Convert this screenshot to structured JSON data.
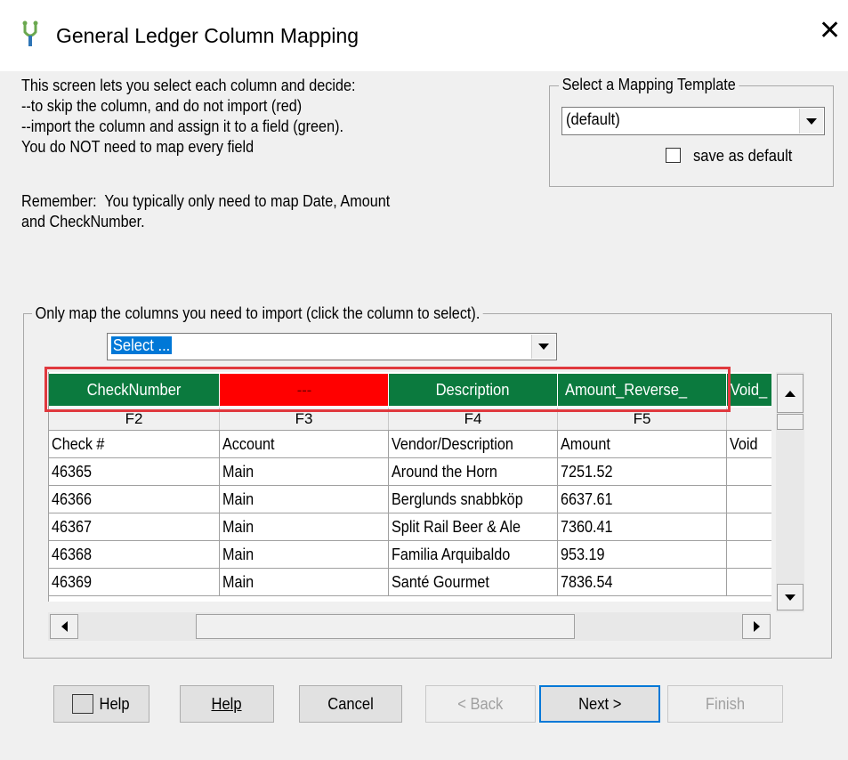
{
  "window": {
    "title": "General Ledger Column Mapping",
    "close_glyph": "✕",
    "app_icon": "app-logo-icon"
  },
  "intro": {
    "text": "This screen lets you select each column and decide:\n--to skip the column, and do not import (red)\n--import the column and assign it to a field (green).\nYou do NOT need to map every field",
    "remember": "Remember:  You typically only need to map Date, Amount\nand CheckNumber."
  },
  "template": {
    "legend": "Select a Mapping Template",
    "value": "(default)",
    "save_default_label": "save as default",
    "save_default_checked": false
  },
  "mapping": {
    "legend": "Only map the columns you need to import (click the column to select).",
    "field_select_value": "Select ...",
    "colors": {
      "mapped": "#0b7a3e",
      "skipped": "#ff0000"
    },
    "map_cells": [
      {
        "label": "CheckNumber",
        "status": "mapped"
      },
      {
        "label": "---",
        "status": "skipped"
      },
      {
        "label": "Description",
        "status": "mapped"
      },
      {
        "label": "Amount_Reverse_",
        "status": "mapped"
      },
      {
        "label": "Void_",
        "status": "mapped"
      }
    ],
    "headers": [
      "F2",
      "F3",
      "F4",
      "F5",
      ""
    ],
    "rows": [
      [
        "Check #",
        "Account",
        "Vendor/Description",
        "Amount",
        "Void"
      ],
      [
        "46365",
        "Main",
        "Around the Horn",
        "7251.52",
        ""
      ],
      [
        "46366",
        "Main",
        "Berglunds snabbköp",
        "6637.61",
        ""
      ],
      [
        "46367",
        "Main",
        "Split Rail Beer & Ale",
        "7360.41",
        ""
      ],
      [
        "46368",
        "Main",
        "Familia Arquibaldo",
        "953.19",
        ""
      ],
      [
        "46369",
        "Main",
        "Santé Gourmet",
        "7836.54",
        ""
      ]
    ]
  },
  "buttons": {
    "help_icon": "help-book-icon",
    "help_icon_label": "Help",
    "help": "Help",
    "cancel": "Cancel",
    "back": "< Back",
    "next": "Next >",
    "finish": "Finish"
  }
}
